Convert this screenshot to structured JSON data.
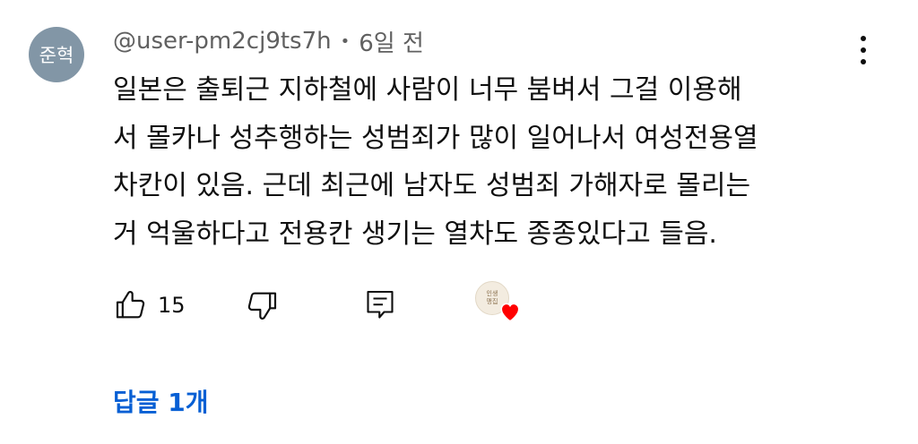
{
  "author": {
    "avatar_text": "준혁",
    "avatar_color": "#8296a6",
    "handle": "@user-pm2cj9ts7h",
    "separator": "•",
    "time": "6일 전"
  },
  "comment": {
    "text": "일본은 출퇴근 지하철에 사람이 너무 붐벼서 그걸 이용해\n서 몰카나 성추행하는 성범죄가 많이 일어나서 여성전용열\n차칸이 있음. 근데 최근에 남자도 성범죄 가해자로 몰리는\n거 억울하다고 전용칸 생기는 열차도 종종있다고 들음."
  },
  "actions": {
    "like_icon": "thumbs-up-icon",
    "like_count": "15",
    "dislike_icon": "thumbs-down-icon",
    "reply_icon": "reply-comment-icon",
    "creator_heart_icon": "creator-heart-icon",
    "heart_avatar_text": [
      "인생",
      "맹집"
    ],
    "heart_color": "#ff0000"
  },
  "more_menu_icon": "vertical-ellipsis-icon",
  "replies": {
    "label": "답글 1개",
    "color": "#065fd4"
  }
}
